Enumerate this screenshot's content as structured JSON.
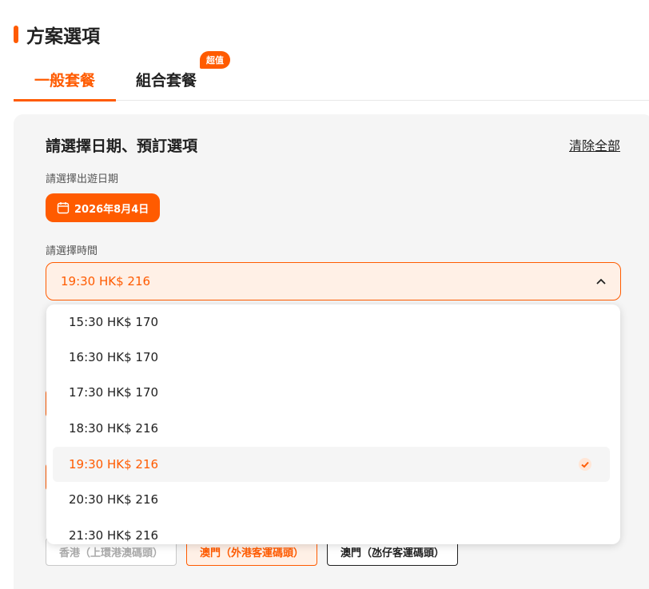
{
  "section": {
    "title": "方案選項"
  },
  "tabs": [
    {
      "label": "一般套餐",
      "active": true
    },
    {
      "label": "組合套餐",
      "active": false,
      "badge": "超值"
    }
  ],
  "panel": {
    "heading": "請選擇日期、預訂選項",
    "clear_all": "清除全部",
    "date_label": "請選擇出遊日期",
    "date_value": "2026年8月4日",
    "time_label": "請選擇時間",
    "time_selected": "19:30 HK$ 216",
    "piers": [
      {
        "label": "香港（上環港澳碼頭）",
        "state": "disabled"
      },
      {
        "label": "澳門（外港客運碼頭）",
        "state": "selected"
      },
      {
        "label": "澳門（氹仔客運碼頭）",
        "state": "normal"
      }
    ]
  },
  "time_options": [
    {
      "label": "15:30 HK$ 170",
      "selected": false
    },
    {
      "label": "16:30 HK$ 170",
      "selected": false
    },
    {
      "label": "17:30 HK$ 170",
      "selected": false
    },
    {
      "label": "18:30 HK$ 216",
      "selected": false
    },
    {
      "label": "19:30 HK$ 216",
      "selected": true
    },
    {
      "label": "20:30 HK$ 216",
      "selected": false
    },
    {
      "label": "21:30 HK$ 216",
      "selected": false
    }
  ],
  "colors": {
    "accent": "#ff5b00",
    "accent_light": "#fff0e6",
    "panel_bg": "#f5f5f5"
  }
}
